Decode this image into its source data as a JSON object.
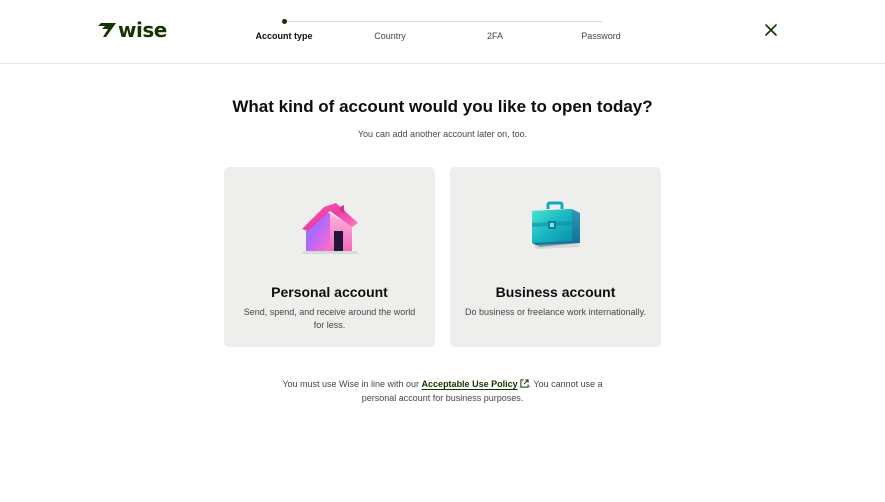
{
  "brand": {
    "logo_text": "wise",
    "logo_icon": "wise-flag-icon",
    "color": "#163300"
  },
  "stepper": {
    "steps": [
      {
        "label": "Account type",
        "active": true
      },
      {
        "label": "Country",
        "active": false
      },
      {
        "label": "2FA",
        "active": false
      },
      {
        "label": "Password",
        "active": false
      }
    ]
  },
  "header": {
    "close_icon": "close-icon"
  },
  "main": {
    "title": "What kind of account would you like to open today?",
    "subtitle": "You can add another account later on, too."
  },
  "cards": [
    {
      "title": "Personal account",
      "description": "Send, spend, and receive around the world for less.",
      "icon": "house-icon"
    },
    {
      "title": "Business account",
      "description": "Do business or freelance work internationally.",
      "icon": "briefcase-icon"
    }
  ],
  "footer": {
    "text_before": "You must use Wise in line with our ",
    "link_label": "Acceptable Use Policy",
    "link_icon": "external-link-icon",
    "text_after": ". You cannot use a personal account for business purposes."
  },
  "colors": {
    "accent": "#163300",
    "card_bg": "#eeefed",
    "text": "#0e0f0c",
    "muted": "#454745"
  }
}
